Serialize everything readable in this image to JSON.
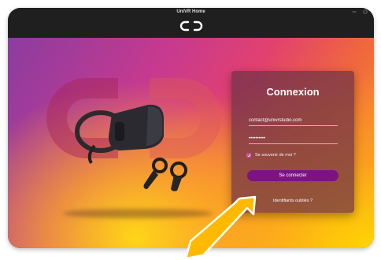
{
  "window": {
    "title": "UniVR Home"
  },
  "colors": {
    "accent": "#7d1383",
    "titlebar": "#1f1f1f",
    "arrow": "#ffba00",
    "checkbox": "#d9479a"
  },
  "login": {
    "heading": "Connexion",
    "email_value": "contact@univrstudio.com",
    "password_value": "••••••••••",
    "remember_label": "Se souvenir de moi ?",
    "remember_checked": true,
    "submit_label": "Se connecter",
    "forgot_label": "Identifiants oubliés ?"
  },
  "icons": [
    "univr-logo-icon",
    "minimize-icon",
    "close-icon",
    "check-icon",
    "vr-headset-icon",
    "vr-controllers-icon",
    "pointer-arrow-icon"
  ]
}
